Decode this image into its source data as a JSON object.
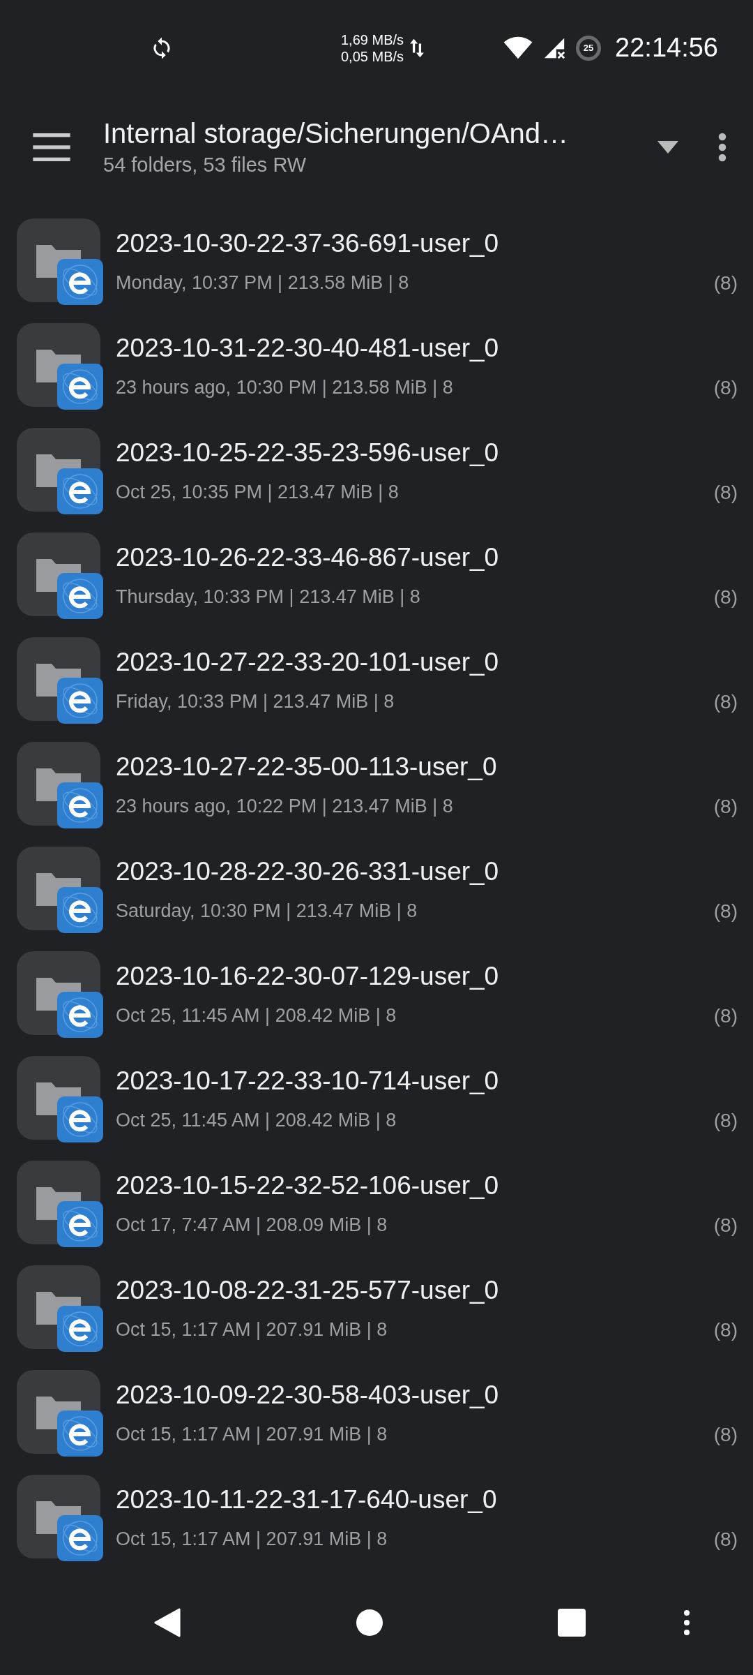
{
  "status_bar": {
    "speed_up": "1,69 MB/s",
    "speed_down": "0,05 MB/s",
    "battery": "25",
    "time": "22:14:56"
  },
  "toolbar": {
    "title": "Internal storage/Sicherungen/OAnd…",
    "subtitle": "54 folders, 53 files RW"
  },
  "rows": [
    {
      "name": "2023-10-30-22-37-36-691-user_0",
      "details": "Monday, 10:37 PM | 213.58 MiB | 8",
      "count": "(8)"
    },
    {
      "name": "2023-10-31-22-30-40-481-user_0",
      "details": "23 hours ago, 10:30 PM | 213.58 MiB | 8",
      "count": "(8)"
    },
    {
      "name": "2023-10-25-22-35-23-596-user_0",
      "details": "Oct 25, 10:35 PM | 213.47 MiB | 8",
      "count": "(8)"
    },
    {
      "name": "2023-10-26-22-33-46-867-user_0",
      "details": "Thursday, 10:33 PM | 213.47 MiB | 8",
      "count": "(8)"
    },
    {
      "name": "2023-10-27-22-33-20-101-user_0",
      "details": "Friday, 10:33 PM | 213.47 MiB | 8",
      "count": "(8)"
    },
    {
      "name": "2023-10-27-22-35-00-113-user_0",
      "details": "23 hours ago, 10:22 PM | 213.47 MiB | 8",
      "count": "(8)"
    },
    {
      "name": "2023-10-28-22-30-26-331-user_0",
      "details": "Saturday, 10:30 PM | 213.47 MiB | 8",
      "count": "(8)"
    },
    {
      "name": "2023-10-16-22-30-07-129-user_0",
      "details": "Oct 25, 11:45 AM | 208.42 MiB | 8",
      "count": "(8)"
    },
    {
      "name": "2023-10-17-22-33-10-714-user_0",
      "details": "Oct 25, 11:45 AM | 208.42 MiB | 8",
      "count": "(8)"
    },
    {
      "name": "2023-10-15-22-32-52-106-user_0",
      "details": "Oct 17, 7:47 AM | 208.09 MiB | 8",
      "count": "(8)"
    },
    {
      "name": "2023-10-08-22-31-25-577-user_0",
      "details": "Oct 15, 1:17 AM | 207.91 MiB | 8",
      "count": "(8)"
    },
    {
      "name": "2023-10-09-22-30-58-403-user_0",
      "details": "Oct 15, 1:17 AM | 207.91 MiB | 8",
      "count": "(8)"
    },
    {
      "name": "2023-10-11-22-31-17-640-user_0",
      "details": "Oct 15, 1:17 AM | 207.91 MiB | 8",
      "count": "(8)"
    }
  ]
}
